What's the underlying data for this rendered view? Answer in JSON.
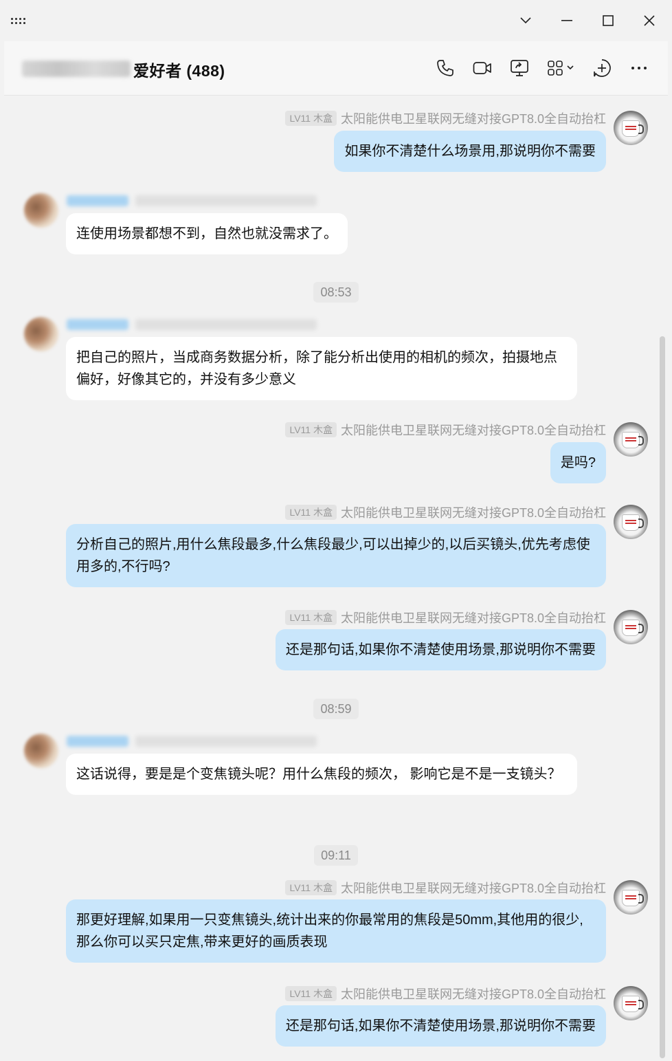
{
  "window": {
    "buttons": [
      "dropdown",
      "minimize",
      "maximize",
      "close"
    ]
  },
  "header": {
    "title": "爱好者 (488)",
    "icons": [
      "phone-icon",
      "video-icon",
      "screen-share-icon",
      "apps-icon",
      "add-icon",
      "more-icon"
    ]
  },
  "me": {
    "badge": "LV11 木盒",
    "nickname": "太阳能供电卫星联网无缝对接GPT8.0全自动抬杠"
  },
  "timestamps": [
    "08:53",
    "08:59",
    "09:11"
  ],
  "messages": [
    {
      "from": "me",
      "text": "如果你不清楚什么场景用,那说明你不需要"
    },
    {
      "from": "other",
      "text": "连使用场景都想不到，自然也就没需求了。"
    },
    {
      "from": "other",
      "text": "把自己的照片，当成商务数据分析，除了能分析出使用的相机的频次，拍摄地点偏好，好像其它的，并没有多少意义"
    },
    {
      "from": "me",
      "text": "是吗?"
    },
    {
      "from": "me",
      "text": "分析自己的照片,用什么焦段最多,什么焦段最少,可以出掉少的,以后买镜头,优先考虑使用多的,不行吗?"
    },
    {
      "from": "me",
      "text": "还是那句话,如果你不清楚使用场景,那说明你不需要"
    },
    {
      "from": "other",
      "text": "这话说得，要是是个变焦镜头呢？用什么焦段的频次， 影响它是不是一支镜头？"
    },
    {
      "from": "me",
      "text": "那更好理解,如果用一只变焦镜头,统计出来的你最常用的焦段是50mm,其他用的很少,那么你可以买只定焦,带来更好的画质表现"
    },
    {
      "from": "me",
      "text": "还是那句话,如果你不清楚使用场景,那说明你不需要"
    }
  ]
}
